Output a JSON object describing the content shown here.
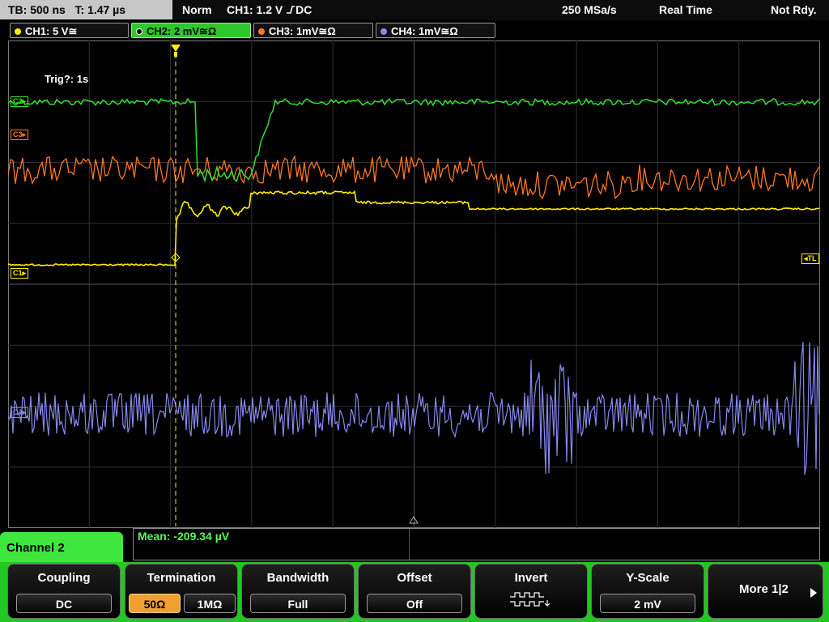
{
  "topbar": {
    "timebase": "TB: 500 ns",
    "trigger_time": "T: 1.47 µs",
    "mode": "Norm",
    "trigger_source": "CH1: 1.2 V",
    "trigger_coupling": "DC",
    "sample_rate": "250 MSa/s",
    "acq_mode": "Real Time",
    "status": "Not Rdy."
  },
  "channels": [
    {
      "label": "CH1: 5 V≅",
      "color": "#ffee00",
      "active": false
    },
    {
      "label": "CH2: 2 mV≅Ω",
      "color": "#30e030",
      "active": true
    },
    {
      "label": "CH3: 1mV≅Ω",
      "color": "#ff7722",
      "active": false
    },
    {
      "label": "CH4: 1mV≅Ω",
      "color": "#8888ee",
      "active": false
    }
  ],
  "screen": {
    "trigger_info": "Trig?: 1s",
    "markers": {
      "c1": "C1",
      "c2": "C2",
      "c3": "C3",
      "c4": "C4",
      "trigger_level": "TL"
    }
  },
  "channel_panel": {
    "title": "Channel 2"
  },
  "measurement": {
    "mean": "Mean: -209.34 µV"
  },
  "softkeys": {
    "coupling": {
      "title": "Coupling",
      "value": "DC"
    },
    "termination": {
      "title": "Termination",
      "option_a": "50Ω",
      "option_b": "1MΩ",
      "selected": "50Ω"
    },
    "bandwidth": {
      "title": "Bandwidth",
      "value": "Full"
    },
    "offset": {
      "title": "Offset",
      "value": "Off"
    },
    "invert": {
      "title": "Invert"
    },
    "yscale": {
      "title": "Y-Scale",
      "value": "2 mV"
    },
    "more": {
      "label": "More 1|2"
    }
  },
  "colors": {
    "ch1": "#ffee00",
    "ch2": "#30e030",
    "ch3": "#ff7722",
    "ch4": "#8888ee",
    "softkey_bar": "#22c722"
  }
}
